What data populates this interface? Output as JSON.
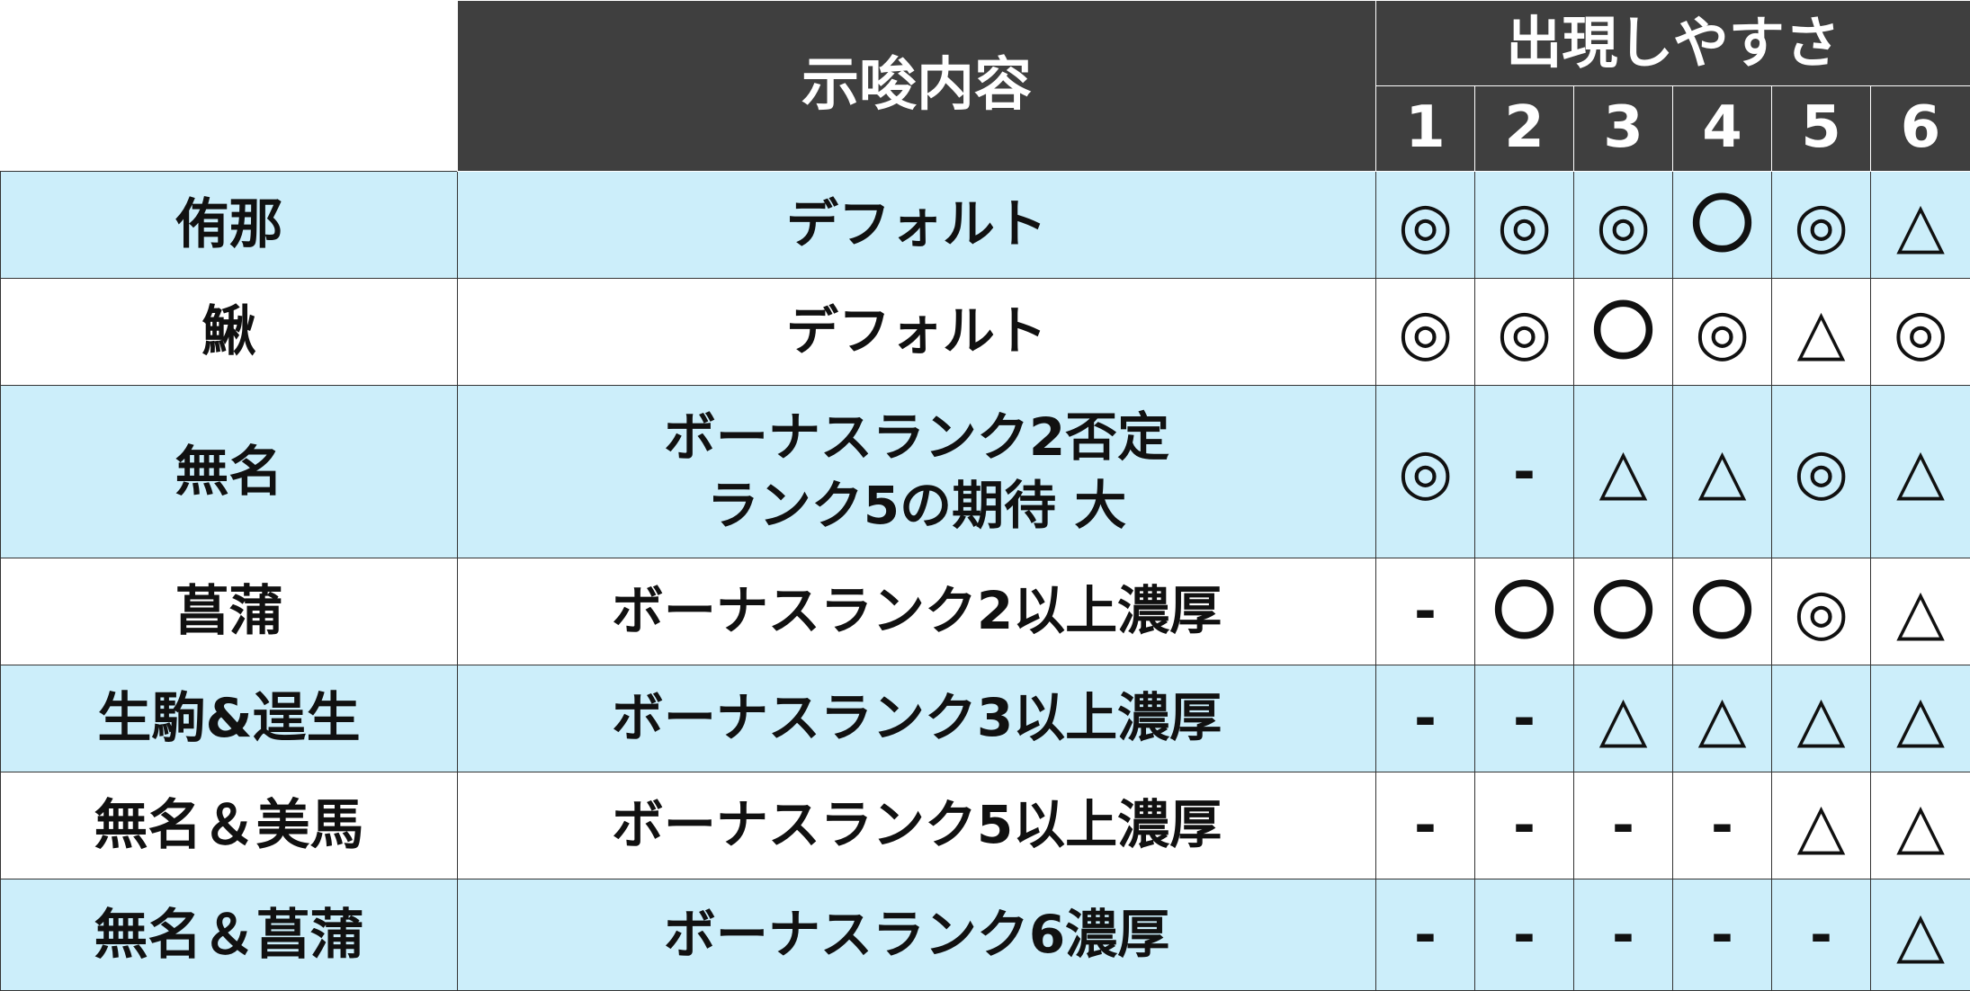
{
  "header": {
    "content_label": "示唆内容",
    "appearance_label": "出現しやすさ",
    "settings": [
      "1",
      "2",
      "3",
      "4",
      "5",
      "6"
    ]
  },
  "rows": [
    {
      "name": "侑那",
      "desc": [
        "デフォルト"
      ],
      "marks": [
        "◎",
        "◎",
        "◎",
        "〇",
        "◎",
        "△"
      ],
      "band": "blue"
    },
    {
      "name": "鰍",
      "desc": [
        "デフォルト"
      ],
      "marks": [
        "◎",
        "◎",
        "〇",
        "◎",
        "△",
        "◎"
      ],
      "band": "white"
    },
    {
      "name": "無名",
      "desc": [
        "ボーナスランク2否定",
        "ランク5の期待 大"
      ],
      "marks": [
        "◎",
        "-",
        "△",
        "△",
        "◎",
        "△"
      ],
      "band": "blue"
    },
    {
      "name": "菖蒲",
      "desc": [
        "ボーナスランク2以上濃厚"
      ],
      "marks": [
        "-",
        "〇",
        "〇",
        "〇",
        "◎",
        "△"
      ],
      "band": "white"
    },
    {
      "name": "生駒&逞生",
      "desc": [
        "ボーナスランク3以上濃厚"
      ],
      "marks": [
        "-",
        "-",
        "△",
        "△",
        "△",
        "△"
      ],
      "band": "blue"
    },
    {
      "name": "無名＆美馬",
      "desc": [
        "ボーナスランク5以上濃厚"
      ],
      "marks": [
        "-",
        "-",
        "-",
        "-",
        "△",
        "△"
      ],
      "band": "white"
    },
    {
      "name": "無名＆菖蒲",
      "desc": [
        "ボーナスランク6濃厚"
      ],
      "marks": [
        "-",
        "-",
        "-",
        "-",
        "-",
        "△"
      ],
      "band": "blue"
    }
  ],
  "colors": {
    "header_bg": "#3f3f3f",
    "row_blue": "#cceefa",
    "row_white": "#ffffff"
  }
}
